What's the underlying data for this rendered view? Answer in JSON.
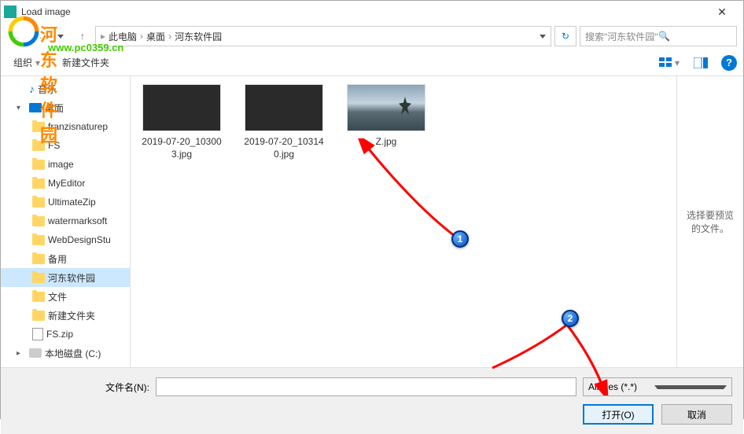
{
  "window": {
    "title": "Load image"
  },
  "pathbar": {
    "crumbs": [
      "此电脑",
      "桌面",
      "河东软件园"
    ],
    "search_placeholder": "搜索\"河东软件园\""
  },
  "toolbar": {
    "organize": "组织",
    "new_folder": "新建文件夹"
  },
  "sidebar": {
    "items": [
      {
        "label": "音乐",
        "icon": "music",
        "indent": 1
      },
      {
        "label": "桌面",
        "icon": "desktop",
        "indent": 1,
        "expanded": true
      },
      {
        "label": "franzisnaturep",
        "icon": "folder",
        "indent": 2
      },
      {
        "label": "FS",
        "icon": "folder",
        "indent": 2
      },
      {
        "label": "image",
        "icon": "folder",
        "indent": 2
      },
      {
        "label": "MyEditor",
        "icon": "folder",
        "indent": 2
      },
      {
        "label": "UltimateZip",
        "icon": "folder",
        "indent": 2
      },
      {
        "label": "watermarksoft",
        "icon": "folder",
        "indent": 2
      },
      {
        "label": "WebDesignStu",
        "icon": "folder",
        "indent": 2
      },
      {
        "label": "备用",
        "icon": "folder",
        "indent": 2
      },
      {
        "label": "河东软件园",
        "icon": "folder",
        "indent": 2,
        "selected": true
      },
      {
        "label": "文件",
        "icon": "folder",
        "indent": 2
      },
      {
        "label": "新建文件夹",
        "icon": "folder",
        "indent": 2
      },
      {
        "label": "FS.zip",
        "icon": "zip",
        "indent": 2
      },
      {
        "label": "本地磁盘 (C:)",
        "icon": "disk",
        "indent": 1
      }
    ]
  },
  "files": [
    {
      "name": "2019-07-20_103003.jpg",
      "thumb": "dark"
    },
    {
      "name": "2019-07-20_103140.jpg",
      "thumb": "dark"
    },
    {
      "name": "Z.jpg",
      "thumb": "image"
    }
  ],
  "preview": {
    "text": "选择要预览的文件。"
  },
  "bottom": {
    "filename_label": "文件名(N):",
    "filename_value": "",
    "filter_value": "All files (*.*)",
    "open_button": "打开(O)",
    "cancel_button": "取消"
  },
  "watermark": {
    "text": "河东软件园",
    "url": "www.pc0359.cn"
  },
  "annotations": {
    "step1": "1",
    "step2": "2"
  }
}
